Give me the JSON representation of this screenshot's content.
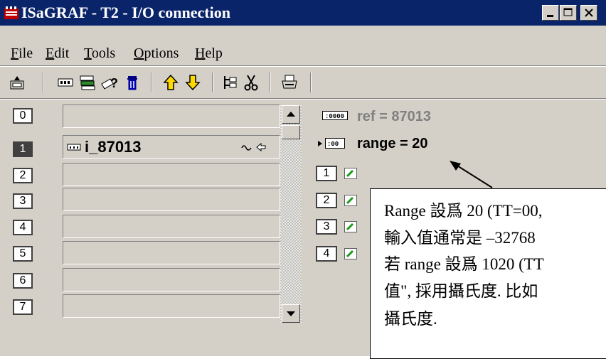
{
  "window": {
    "title": "ISaGRAF - T2 - I/O connection",
    "title_bar_color": "#0a246a",
    "controls": [
      "minimize",
      "maximize",
      "close"
    ]
  },
  "menu": {
    "items": [
      "File",
      "Edit",
      "Tools",
      "Options",
      "Help"
    ]
  },
  "toolbar": {
    "icons": [
      "open-board-icon",
      "board-icon",
      "equipment-icon",
      "help-board-icon",
      "delete-icon",
      "move-up-icon",
      "move-down-icon",
      "tree-icon",
      "cut-icon",
      "print-icon"
    ]
  },
  "slots": [
    {
      "number": "0",
      "name": "",
      "active": false
    },
    {
      "number": "1",
      "name": "i_87013",
      "active": true
    },
    {
      "number": "2",
      "name": "",
      "active": false
    },
    {
      "number": "3",
      "name": "",
      "active": false
    },
    {
      "number": "4",
      "name": "",
      "active": false
    },
    {
      "number": "5",
      "name": "",
      "active": false
    },
    {
      "number": "6",
      "name": "",
      "active": false
    },
    {
      "number": "7",
      "name": "",
      "active": false
    }
  ],
  "params": {
    "ref": "ref = 87013",
    "range": "range = 20"
  },
  "channels": [
    "1",
    "2",
    "3",
    "4"
  ],
  "callout": {
    "lines": [
      "Range 設爲 20 (TT=00,",
      "輸入值通常是 –32768",
      "若 range 設爲 1020 (TT",
      "值\", 採用攝氏度. 比如",
      "攝氏度."
    ]
  }
}
